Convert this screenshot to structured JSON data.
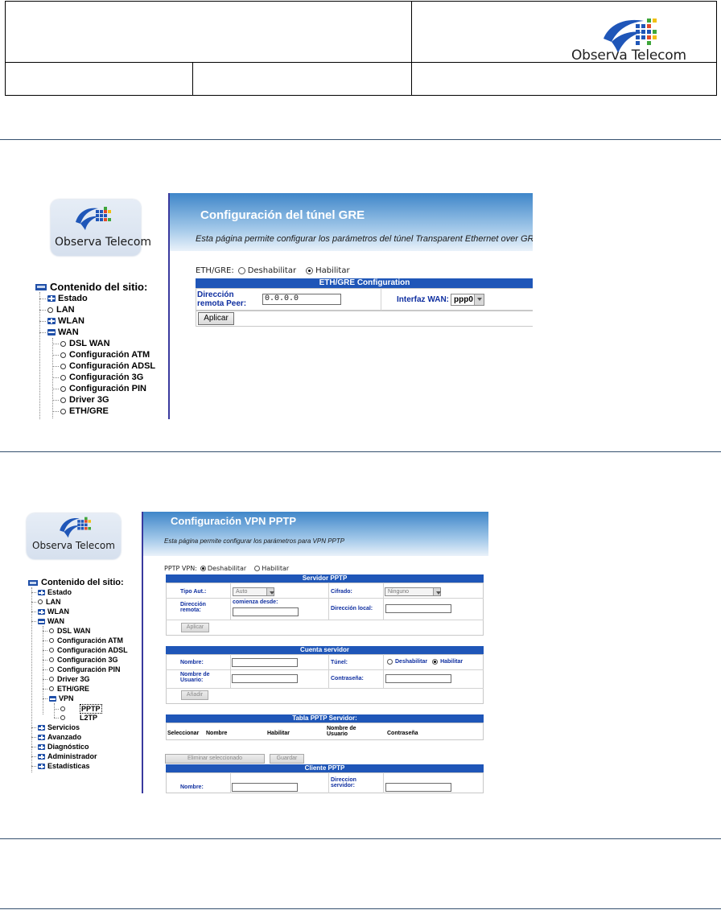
{
  "header": {
    "brand_name": "Observa Telecom"
  },
  "gre_screen": {
    "logo_text": "Observa Telecom",
    "sidebar_title": "Contenido del sitio:",
    "tree": [
      {
        "label": "Estado",
        "kind": "plus"
      },
      {
        "label": "LAN",
        "kind": "dot"
      },
      {
        "label": "WLAN",
        "kind": "plus"
      },
      {
        "label": "WAN",
        "kind": "minus"
      },
      {
        "label": "DSL WAN",
        "kind": "sub"
      },
      {
        "label": "Configuración ATM",
        "kind": "sub"
      },
      {
        "label": "Configuración ADSL",
        "kind": "sub"
      },
      {
        "label": "Configuración 3G",
        "kind": "sub"
      },
      {
        "label": "Configuración PIN",
        "kind": "sub"
      },
      {
        "label": "Driver 3G",
        "kind": "sub"
      },
      {
        "label": "ETH/GRE",
        "kind": "sub"
      }
    ],
    "title": "Configuración del túnel GRE",
    "description": "Esta página permite configurar los parámetros del túnel Transparent Ethernet over GRE.",
    "mode_label": "ETH/GRE:",
    "mode_options": [
      "Deshabilitar",
      "Habilitar"
    ],
    "mode_selected": "Habilitar",
    "section_title": "ETH/GRE Configuration",
    "peer_label": "Dirección remota Peer:",
    "peer_value": "0.0.0.0",
    "wan_label": "Interfaz WAN:",
    "wan_value": "ppp0",
    "apply_label": "Aplicar"
  },
  "pptp_screen": {
    "logo_text": "Observa Telecom",
    "sidebar_title": "Contenido del sitio:",
    "tree": [
      {
        "label": "Estado",
        "kind": "plus"
      },
      {
        "label": "LAN",
        "kind": "dot"
      },
      {
        "label": "WLAN",
        "kind": "plus"
      },
      {
        "label": "WAN",
        "kind": "minus"
      },
      {
        "label": "DSL WAN",
        "kind": "sub"
      },
      {
        "label": "Configuración ATM",
        "kind": "sub"
      },
      {
        "label": "Configuración ADSL",
        "kind": "sub"
      },
      {
        "label": "Configuración 3G",
        "kind": "sub"
      },
      {
        "label": "Configuración PIN",
        "kind": "sub"
      },
      {
        "label": "Driver 3G",
        "kind": "sub"
      },
      {
        "label": "ETH/GRE",
        "kind": "sub"
      },
      {
        "label": "VPN",
        "kind": "subminus"
      },
      {
        "label": "PPTP",
        "kind": "leaf-selected"
      },
      {
        "label": "L2TP",
        "kind": "leaf"
      },
      {
        "label": "Servicios",
        "kind": "plus"
      },
      {
        "label": "Avanzado",
        "kind": "plus"
      },
      {
        "label": "Diagnóstico",
        "kind": "plus"
      },
      {
        "label": "Administrador",
        "kind": "plus"
      },
      {
        "label": "Estadísticas",
        "kind": "plus"
      }
    ],
    "title": "Configuración VPN PPTP",
    "description": "Esta página permite configurar los parámetros para VPN PPTP",
    "mode_label": "PPTP VPN:",
    "mode_options": [
      "Deshabilitar",
      "Habilitar"
    ],
    "mode_selected": "Deshabilitar",
    "server": {
      "title": "Servidor PPTP",
      "auth_label": "Tipo Aut.:",
      "auth_value": "Auto",
      "cipher_label": "Cifrado:",
      "cipher_value": "Ninguno",
      "remote_label": "Dirección remota:",
      "start_label": "comienza desde:",
      "start_value": "",
      "local_label": "Dirección local:",
      "local_value": "",
      "apply_label": "Aplicar"
    },
    "account": {
      "title": "Cuenta servidor",
      "name_label": "Nombre:",
      "name_value": "",
      "tunnel_label": "Túnel:",
      "tunnel_options": [
        "Deshabilitar",
        "Habilitar"
      ],
      "tunnel_selected": "Habilitar",
      "user_label": "Nombre de Usuario:",
      "user_value": "",
      "password_label": "Contraseña:",
      "password_value": "",
      "add_label": "Añadir"
    },
    "table": {
      "title": "Tabla PPTP Servidor:",
      "columns": [
        "Seleccionar",
        "Nombre",
        "Habilitar",
        "Nombre de Usuario",
        "Contraseña"
      ]
    },
    "delete_label": "Eliminar seleccionado",
    "save_label": "Guardar",
    "client": {
      "title": "Cliente PPTP",
      "name_label": "Nombre:",
      "name_value": "",
      "server_label": "Direccion servidor:",
      "server_value": ""
    }
  }
}
